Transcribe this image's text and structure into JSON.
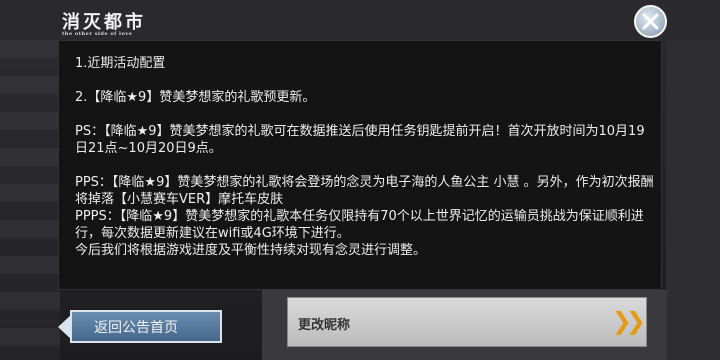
{
  "header": {
    "logo_title": "消灭都市",
    "logo_subtitle": "the other side of love"
  },
  "notice": {
    "lines": [
      "1.近期活动配置",
      "2.【降临★9】赞美梦想家的礼歌预更新。",
      "PS：【降临★9】赞美梦想家的礼歌可在数据推送后使用任务钥匙提前开启！首次开放时间为10月19日21点~10月20日9点。",
      "PPS：【降临★9】赞美梦想家的礼歌将会登场的念灵为电子海的人鱼公主 小慧 。另外，作为初次报酬将掉落【小慧赛车VER】摩托车皮肤",
      "PPPS：【降临★9】赞美梦想家的礼歌本任务仅限持有70个以上世界记忆的运输员挑战为保证顺利进行，每次数据更新建议在wifi或4G环境下进行。",
      "今后我们将根据游戏进度及平衡性持续对现有念灵进行调整。"
    ]
  },
  "footer": {
    "back_label": "返回公告首页",
    "rename_label": "更改昵称",
    "rename_chevron": "❯❯"
  },
  "colors": {
    "accent_blue": "#45678c",
    "chevron_orange": "#e39a15"
  }
}
